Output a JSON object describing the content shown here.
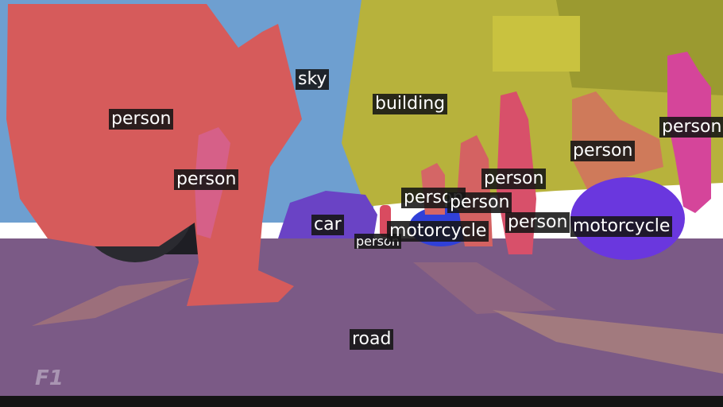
{
  "image": {
    "segments": [
      {
        "class": "sky",
        "color": "#6a9ccf"
      },
      {
        "class": "building",
        "color": "#b9b43a"
      },
      {
        "class": "road",
        "color": "#7e5a86"
      },
      {
        "class": "person",
        "color": "#d65a5a"
      },
      {
        "class": "person",
        "color": "#d84b8a"
      },
      {
        "class": "car",
        "color": "#6a42c4"
      },
      {
        "class": "motorcycle",
        "color": "#6836e0"
      },
      {
        "class": "motorcycle",
        "color": "#2f3fd8"
      }
    ],
    "labels": {
      "sky": "sky",
      "building": "building",
      "person_1": "person",
      "person_2": "person",
      "person_3": "person",
      "person_4": "person",
      "person_5": "person",
      "person_6": "person",
      "person_7": "person",
      "person_8": "person",
      "person_9": "person",
      "car": "car",
      "motorcycle_1": "motorcycle",
      "motorcycle_2": "motorcycle",
      "road": "road"
    },
    "logo_text": "F1"
  }
}
